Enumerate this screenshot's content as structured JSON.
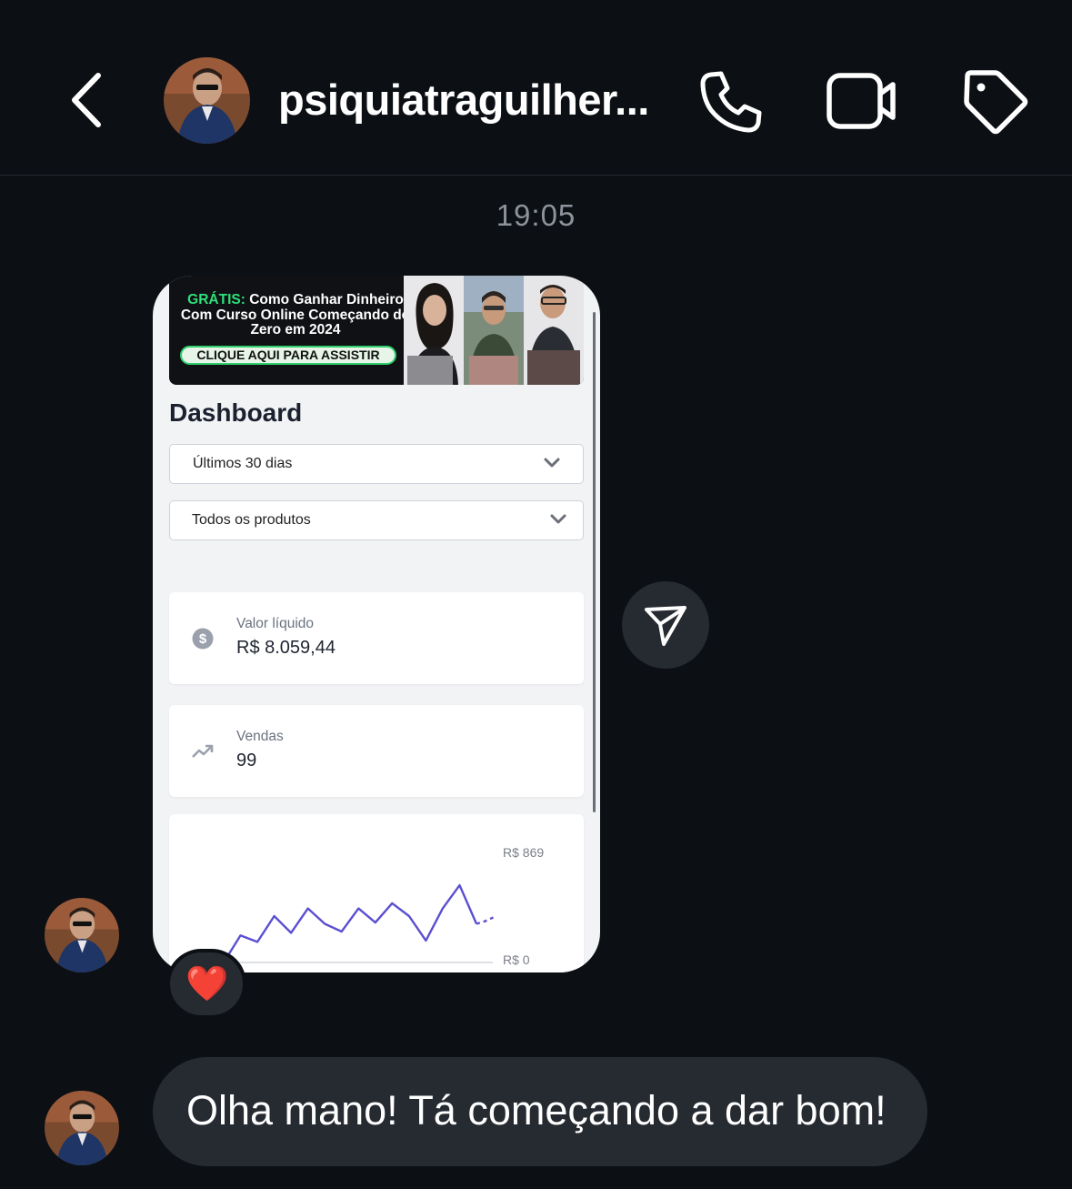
{
  "header": {
    "title": "psiquiatraguilher...",
    "back_icon": "chevron-left-icon",
    "call_icon": "phone-icon",
    "video_icon": "video-camera-icon",
    "tag_icon": "tag-icon"
  },
  "timestamp": "19:05",
  "shared_screenshot": {
    "banner": {
      "highlight": "GRÁTIS:",
      "text": "Como Ganhar Dinheiro Com Curso Online Começando do Zero em 2024",
      "cta": "CLIQUE AQUI PARA ASSISTIR"
    },
    "dashboard": {
      "title": "Dashboard",
      "period_filter": "Últimos 30 dias",
      "product_filter": "Todos os produtos",
      "net_value_label": "Valor líquido",
      "net_value": "R$ 8.059,44",
      "sales_label": "Vendas",
      "sales_value": "99",
      "chart_max_label": "R$ 869",
      "chart_min_label": "R$ 0"
    }
  },
  "chart_data": {
    "type": "line",
    "title": "",
    "ylim": [
      0,
      869
    ],
    "y_tick_labels": [
      "R$ 869",
      "R$ 0"
    ],
    "series": [
      {
        "values": [
          0,
          210,
          160,
          360,
          230,
          420,
          300,
          240,
          420,
          310,
          460,
          360,
          170,
          420,
          600,
          300
        ],
        "projected_values": [
          300,
          320,
          350
        ]
      }
    ]
  },
  "reaction": "❤️",
  "message": "Olha mano! Tá começando a dar bom!",
  "accent_colors": {
    "background": "#0c0f14",
    "bubble": "#262a31",
    "chart_line": "#5b4fd1",
    "banner_green": "#2ee07a"
  }
}
